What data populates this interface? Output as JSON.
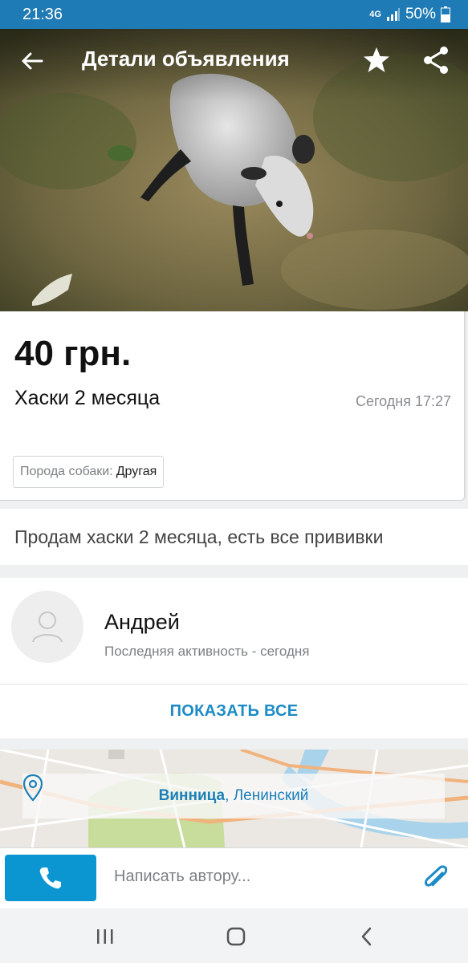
{
  "status_bar": {
    "time": "21:36",
    "network": "4G",
    "battery": "50%",
    "icons": [
      "signal-icon",
      "battery-icon"
    ]
  },
  "header": {
    "title": "Детали объявления",
    "icons": [
      "back-arrow-icon",
      "star-icon",
      "share-icon"
    ]
  },
  "listing": {
    "price": "40 грн.",
    "title": "Хаски 2 месяца",
    "date": "Сегодня 17:27",
    "attribute": {
      "key": "Порода собаки:",
      "value": "Другая"
    },
    "description": "Продам хаски 2 месяца, есть все прививки"
  },
  "seller": {
    "name": "Андрей",
    "activity": "Последняя активность - сегодня",
    "show_all_label": "ПОКАЗАТЬ ВСЕ",
    "avatar_icon": "user-avatar-icon"
  },
  "location": {
    "city": "Винница",
    "separator": ", ",
    "district": "Ленинский",
    "icon": "location-pin-icon"
  },
  "message_bar": {
    "placeholder": "Написать автору...",
    "icons": [
      "phone-icon",
      "paperclip-icon"
    ]
  },
  "nav_bar": {
    "icons": [
      "recent-apps-icon",
      "home-icon",
      "back-icon"
    ]
  },
  "colors": {
    "status_bar": "#1f7bb5",
    "accent": "#1d8bc6",
    "call_button": "#0b96d2"
  }
}
